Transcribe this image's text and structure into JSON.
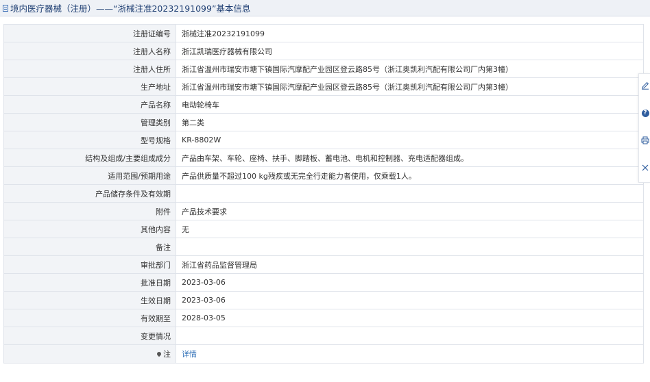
{
  "header": {
    "title": "境内医疗器械（注册）——“浙械注准20232191099”基本信息"
  },
  "rows": [
    {
      "label": "注册证编号",
      "value": "浙械注准20232191099"
    },
    {
      "label": "注册人名称",
      "value": "浙江凯瑞医疗器械有限公司"
    },
    {
      "label": "注册人住所",
      "value": "浙江省温州市瑞安市塘下镇国际汽摩配产业园区登云路85号（浙江奥凯利汽配有限公司厂内第3幢）"
    },
    {
      "label": "生产地址",
      "value": "浙江省温州市瑞安市塘下镇国际汽摩配产业园区登云路85号（浙江奥凯利汽配有限公司厂内第3幢）"
    },
    {
      "label": "产品名称",
      "value": "电动轮椅车"
    },
    {
      "label": "管理类别",
      "value": "第二类"
    },
    {
      "label": "型号规格",
      "value": "KR-8802W"
    },
    {
      "label": "结构及组成/主要组成成分",
      "value": "产品由车架、车轮、座椅、扶手、脚踏板、蓄电池、电机和控制器、充电适配器组成。"
    },
    {
      "label": "适用范围/预期用途",
      "value": "产品供质量不超过100 kg残疾或无完全行走能力者使用，仅乘载1人。"
    },
    {
      "label": "产品储存条件及有效期",
      "value": ""
    },
    {
      "label": "附件",
      "value": "产品技术要求"
    },
    {
      "label": "其他内容",
      "value": "无"
    },
    {
      "label": "备注",
      "value": ""
    },
    {
      "label": "审批部门",
      "value": "浙江省药品监督管理局"
    },
    {
      "label": "批准日期",
      "value": "2023-03-06"
    },
    {
      "label": "生效日期",
      "value": "2023-03-06"
    },
    {
      "label": "有效期至",
      "value": "2028-03-05"
    },
    {
      "label": "变更情况",
      "value": ""
    }
  ],
  "note_row": {
    "label": "注",
    "link": "详情"
  },
  "toolbar": {
    "edit_icon": "edit-icon",
    "help_icon": "help-icon",
    "help_glyph": "?",
    "print_icon": "print-icon",
    "close_icon": "close-icon"
  },
  "colors": {
    "header_bg": "#eef1f6",
    "header_text": "#1f3f73",
    "label_bg": "#f2f4f7",
    "border": "#dfe3ea",
    "link": "#2f6fb7"
  }
}
